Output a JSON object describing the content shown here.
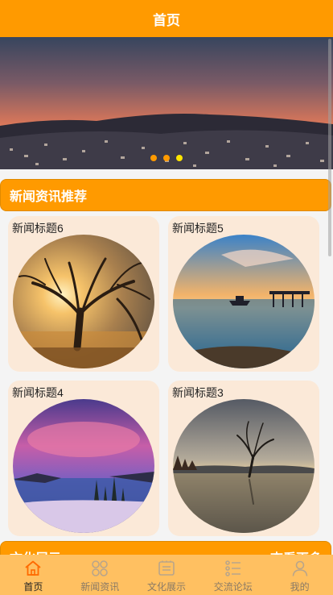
{
  "header": {
    "title": "首页"
  },
  "banner": {
    "dots": 3,
    "active_dot": 3
  },
  "news_section": {
    "title": "新闻资讯推荐"
  },
  "news": [
    {
      "title": "新闻标题6",
      "image": "sunset-tree"
    },
    {
      "title": "新闻标题5",
      "image": "sea-pier"
    },
    {
      "title": "新闻标题4",
      "image": "purple-lake"
    },
    {
      "title": "新闻标题3",
      "image": "lake-tree"
    }
  ],
  "culture_section": {
    "title": "文化展示",
    "more_label": "查看更多"
  },
  "tabs": [
    {
      "label": "首页",
      "icon": "home-icon",
      "active": true
    },
    {
      "label": "新闻资讯",
      "icon": "news-grid-icon",
      "active": false
    },
    {
      "label": "文化展示",
      "icon": "culture-icon",
      "active": false
    },
    {
      "label": "交流论坛",
      "icon": "forum-list-icon",
      "active": false
    },
    {
      "label": "我的",
      "icon": "user-icon",
      "active": false
    }
  ],
  "colors": {
    "accent": "#ff9a00",
    "tabbar": "#ffc061",
    "card": "#fbe9d8",
    "active_dot": "#ffe500"
  }
}
